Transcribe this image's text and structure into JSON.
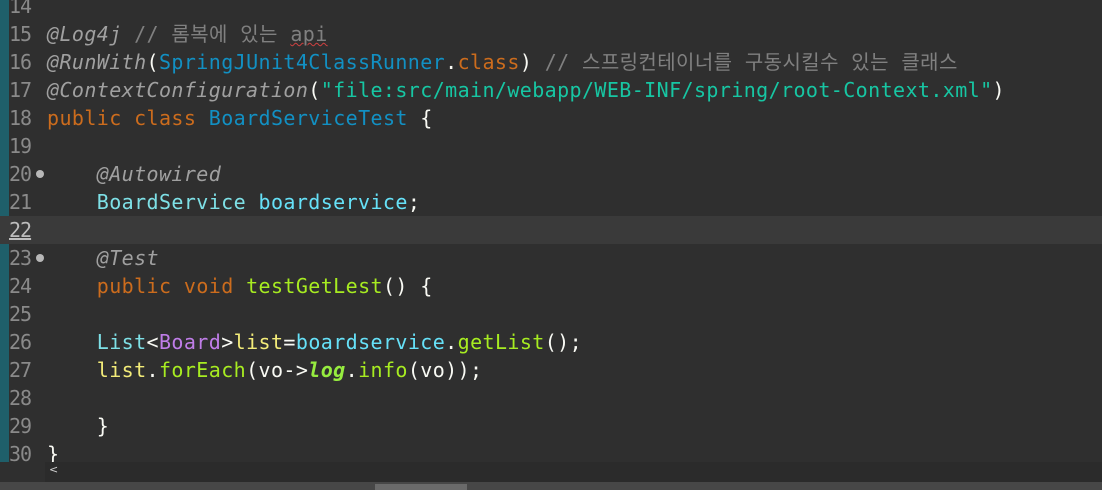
{
  "editor": {
    "lines": [
      {
        "n": "14",
        "tokens": []
      },
      {
        "n": "15",
        "tokens": [
          {
            "c": "ann",
            "t": "@Log4j"
          },
          {
            "c": "cmt",
            "t": " // 롬복에 있는 "
          },
          {
            "c": "cmt wavy",
            "t": "api"
          }
        ]
      },
      {
        "n": "16",
        "tokens": [
          {
            "c": "ann",
            "t": "@RunWith"
          },
          {
            "c": "punc",
            "t": "("
          },
          {
            "c": "type",
            "t": "SpringJUnit4ClassRunner"
          },
          {
            "c": "punc",
            "t": "."
          },
          {
            "c": "kw",
            "t": "class"
          },
          {
            "c": "punc",
            "t": ")"
          },
          {
            "c": "cmt",
            "t": " // 스프링컨테이너를 구동시킬수 있는 클래스"
          }
        ]
      },
      {
        "n": "17",
        "tokens": [
          {
            "c": "ann",
            "t": "@ContextConfiguration"
          },
          {
            "c": "punc",
            "t": "("
          },
          {
            "c": "str",
            "t": "\"file:src/main/webapp/WEB-INF/spring/root-Context.xml\""
          },
          {
            "c": "punc",
            "t": ")"
          }
        ]
      },
      {
        "n": "18",
        "tokens": [
          {
            "c": "kw",
            "t": "public"
          },
          {
            "c": "punc",
            "t": " "
          },
          {
            "c": "kw",
            "t": "class"
          },
          {
            "c": "punc",
            "t": " "
          },
          {
            "c": "type",
            "t": "BoardServiceTest"
          },
          {
            "c": "punc",
            "t": " {"
          }
        ]
      },
      {
        "n": "19",
        "tokens": []
      },
      {
        "n": "20",
        "fold": true,
        "tokens": [
          {
            "c": "punc",
            "t": "    "
          },
          {
            "c": "ann",
            "t": "@Autowired"
          }
        ]
      },
      {
        "n": "21",
        "tokens": [
          {
            "c": "punc",
            "t": "    "
          },
          {
            "c": "cls",
            "t": "BoardService"
          },
          {
            "c": "punc",
            "t": " "
          },
          {
            "c": "fld",
            "t": "boardservice"
          },
          {
            "c": "punc",
            "t": ";"
          }
        ]
      },
      {
        "n": "22",
        "current": true,
        "tokens": []
      },
      {
        "n": "23",
        "fold": true,
        "tokens": [
          {
            "c": "punc",
            "t": "    "
          },
          {
            "c": "ann",
            "t": "@Test"
          }
        ]
      },
      {
        "n": "24",
        "tokens": [
          {
            "c": "punc",
            "t": "    "
          },
          {
            "c": "kw",
            "t": "public"
          },
          {
            "c": "punc",
            "t": " "
          },
          {
            "c": "kw",
            "t": "void"
          },
          {
            "c": "punc",
            "t": " "
          },
          {
            "c": "meth",
            "t": "testGetLest"
          },
          {
            "c": "punc",
            "t": "() {"
          }
        ]
      },
      {
        "n": "25",
        "tokens": []
      },
      {
        "n": "26",
        "tokens": [
          {
            "c": "punc",
            "t": "    "
          },
          {
            "c": "cls",
            "t": "List"
          },
          {
            "c": "punc",
            "t": "<"
          },
          {
            "c": "gen",
            "t": "Board"
          },
          {
            "c": "punc",
            "t": ">"
          },
          {
            "c": "lvar",
            "t": "list"
          },
          {
            "c": "punc",
            "t": "="
          },
          {
            "c": "fld",
            "t": "boardservice"
          },
          {
            "c": "punc",
            "t": "."
          },
          {
            "c": "meth",
            "t": "getList"
          },
          {
            "c": "punc",
            "t": "();"
          }
        ]
      },
      {
        "n": "27",
        "tokens": [
          {
            "c": "punc",
            "t": "    "
          },
          {
            "c": "lvar",
            "t": "list"
          },
          {
            "c": "punc",
            "t": "."
          },
          {
            "c": "meth",
            "t": "forEach"
          },
          {
            "c": "punc",
            "t": "(vo->"
          },
          {
            "c": "stat",
            "t": "log"
          },
          {
            "c": "punc",
            "t": "."
          },
          {
            "c": "meth",
            "t": "info"
          },
          {
            "c": "punc",
            "t": "(vo));"
          }
        ]
      },
      {
        "n": "28",
        "tokens": []
      },
      {
        "n": "29",
        "tokens": [
          {
            "c": "punc",
            "t": "    }"
          }
        ]
      },
      {
        "n": "30",
        "tokens": [
          {
            "c": "punc",
            "t": "}"
          }
        ]
      }
    ]
  },
  "scrollbar": {
    "left_arrow": "<",
    "left_arrow_icon": "chevron-left-icon"
  }
}
